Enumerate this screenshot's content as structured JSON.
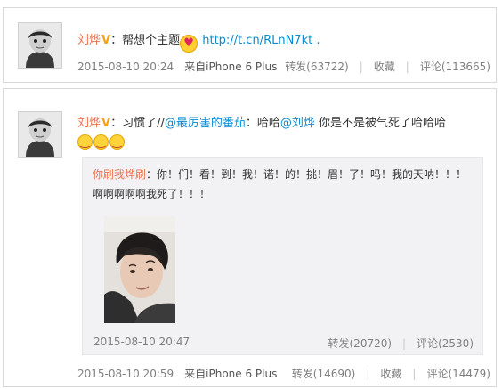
{
  "post1": {
    "author": "刘烨",
    "vip_badge": "V",
    "colon": "：",
    "text": "帮想个主题",
    "emoji_icon": "heart-eyes-emoji",
    "link": "http://t.cn/RLnN7kt",
    "trailing": " .",
    "time": "2015-08-10 20:24",
    "source": "来自iPhone 6 Plus",
    "actions": {
      "repost": "转发(63722)",
      "fav": "收藏",
      "comment": "评论(113665)"
    }
  },
  "post2": {
    "author": "刘烨",
    "vip_badge": "V",
    "colon": "：",
    "text_a": "习惯了//",
    "mention_a": "@最厉害的番茄",
    "text_b": "：哈哈",
    "mention_b": "@刘烨",
    "text_c": " 你是不是被气死了哈哈哈",
    "emoji_icons": [
      "laughing-emoji",
      "laughing-emoji",
      "laughing-emoji"
    ],
    "time": "2015-08-10 20:59",
    "source": "来自iPhone 6 Plus",
    "actions": {
      "repost": "转发(14690)",
      "fav": "收藏",
      "comment": "评论(14479)"
    },
    "repost": {
      "author": "你刷我烨刷",
      "colon": "：",
      "text": "你！们！看！到！我！诺！的！挑！眉！了！吗！我的天呐！！！啊啊啊啊啊我死了！！！",
      "photo": "boy-photo",
      "time": "2015-08-10 20:47",
      "actions": {
        "repost": "转发(20720)",
        "comment": "评论(2530)"
      }
    }
  },
  "colors": {
    "name": "#eb7350",
    "link": "#0a8cd2",
    "meta": "#808080",
    "badge": "#f7a11a"
  }
}
